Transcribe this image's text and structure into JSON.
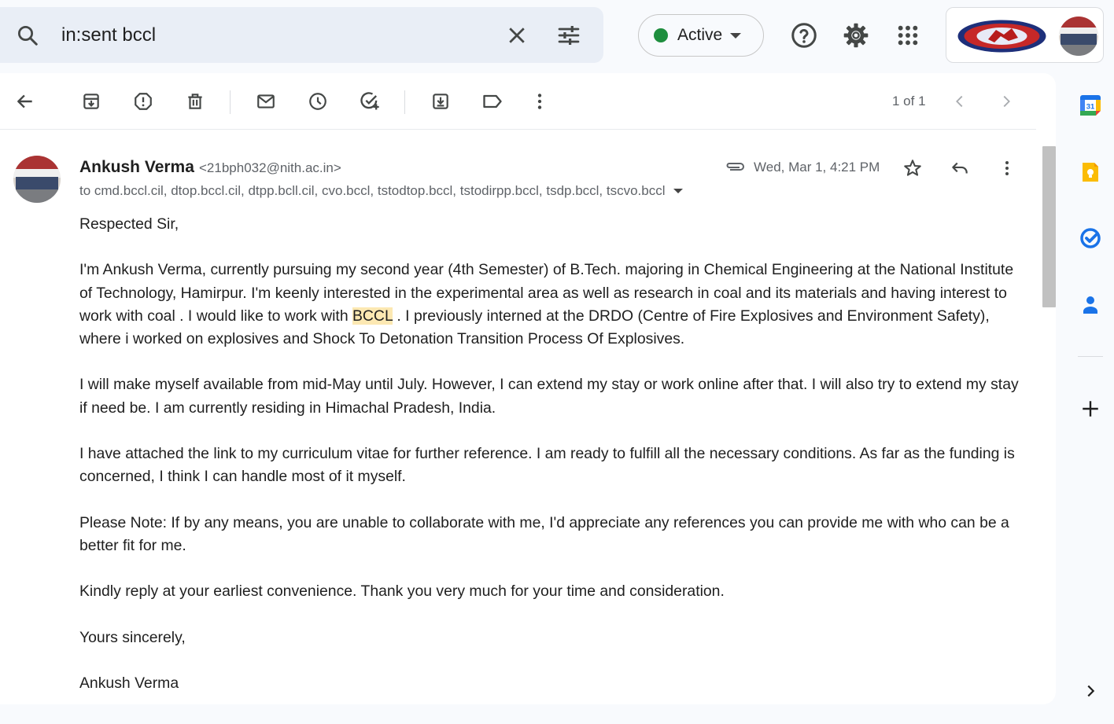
{
  "search": {
    "query": "in:sent bccl"
  },
  "status": {
    "label": "Active",
    "color": "#1e8e3e"
  },
  "top_icons": [
    "help-icon",
    "settings-icon",
    "apps-grid-icon"
  ],
  "toolbar": {
    "icons": [
      "back-arrow-icon",
      "archive-icon",
      "report-spam-icon",
      "delete-icon",
      "mark-unread-icon",
      "snooze-icon",
      "add-to-tasks-icon",
      "move-to-icon",
      "label-icon",
      "more-vert-icon"
    ],
    "pager_text": "1 of 1"
  },
  "message": {
    "sender_name": "Ankush Verma",
    "sender_email": "<21bph032@nith.ac.in>",
    "recipients": "to cmd.bccl.cil, dtop.bccl.cil, dtpp.bcll.cil, cvo.bccl, tstodtop.bccl, tstodirpp.bccl, tsdp.bccl, tscvo.bccl",
    "date": "Wed, Mar 1, 4:21 PM",
    "greeting": "Respected Sir,",
    "p1_before": "I'm Ankush Verma, currently pursuing my second year (4th Semester) of B.Tech. majoring in Chemical Engineering at the National Institute of Technology, Hamirpur. I'm keenly interested in the experimental area as well as research in coal and its materials and having interest to work with coal . I would like to work with ",
    "p1_highlight": "BCCL",
    "p1_after": " . I previously interned at the DRDO (Centre of Fire Explosives and Environment Safety), where i worked on explosives and Shock To Detonation Transition Process Of Explosives.",
    "p2": "I will make myself available from mid-May until July. However, I can extend my stay or work online after that. I will also try to extend my stay if need be. I am currently residing in Himachal Pradesh, India.",
    "p3": "I have attached the link to my curriculum vitae for further reference. I am ready to fulfill all the necessary conditions. As far as the funding is concerned, I think I can handle most of it myself.",
    "p4": "Please Note: If by any means, you are unable to collaborate with me, I'd appreciate any references you can provide me with who can be a better fit for me.",
    "p5": "Kindly reply at your earliest convenience. Thank you very much for your time and consideration.",
    "closing": "Yours sincerely,",
    "signature": "Ankush Verma"
  },
  "side_panel": {
    "calendar_day": "31",
    "icons": [
      "calendar-icon",
      "keep-icon",
      "tasks-icon",
      "contacts-icon",
      "add-addon-icon",
      "expand-panel-icon"
    ]
  }
}
